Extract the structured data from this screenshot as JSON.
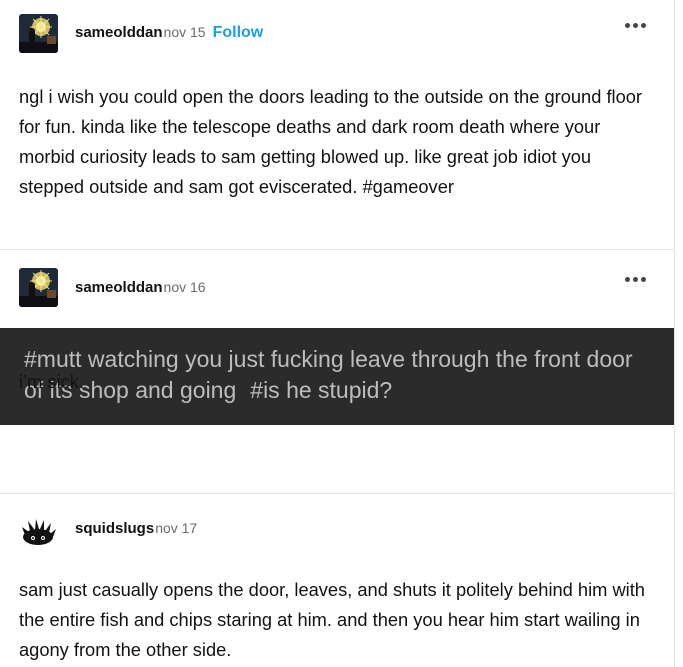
{
  "posts": [
    {
      "username": "sameolddan",
      "date": "nov 15",
      "follow_label": "Follow",
      "body": "ngl i wish you could open the doors leading to the outside on the ground floor for fun. kinda like the telescope deaths and dark room death where your morbid curiosity leads to sam getting blowed up. like great job idiot you stepped outside and sam got eviscerated. #gameover"
    },
    {
      "username": "sameolddan",
      "date": "nov 16",
      "quote_tags": [
        "#mutt watching you just fucking leave through the front door of its shop and going",
        "#is he stupid?"
      ],
      "body": "i’m sick."
    },
    {
      "username": "squidslugs",
      "date": "nov 17",
      "body": "sam just casually opens the door, leaves, and shuts it politely behind him with the entire fish and chips staring at him. and then you hear him start wailing in agony from the other side."
    }
  ],
  "colors": {
    "follow": "#1aa0e6",
    "quote_bg": "#2b2b2b",
    "quote_text": "#bdbdbd"
  },
  "icons": {
    "more": "more-dots-icon"
  }
}
